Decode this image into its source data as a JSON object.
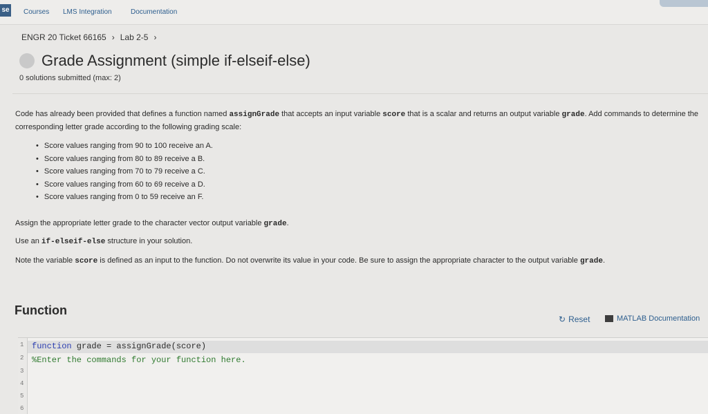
{
  "topbar": {
    "logo_text": "se",
    "nav": [
      "Courses",
      "LMS Integration",
      "Documentation"
    ]
  },
  "breadcrumb": {
    "items": [
      "ENGR 20 Ticket 66165",
      "Lab 2-5"
    ]
  },
  "assignment": {
    "title": "Grade Assignment (simple if-elseif-else)",
    "submitted": "0 solutions submitted (max: 2)"
  },
  "description": {
    "intro_1": "Code has already been provided that defines a function named ",
    "intro_code_1": "assignGrade",
    "intro_2": " that accepts an input variable ",
    "intro_code_2": "score",
    "intro_3": " that is a scalar and returns an output variable ",
    "intro_code_3": "grade",
    "intro_4": ". Add commands to determine the corresponding letter grade according to the following grading scale:",
    "bullets": [
      "Score values ranging from 90 to 100 receive an A.",
      "Score values ranging from 80 to 89 receive a B.",
      "Score values ranging from 70 to 79 receive a C.",
      "Score values ranging from 60 to 69 receive a D.",
      "Score values ranging from 0 to 59 receive an F."
    ],
    "assign_1": "Assign the appropriate letter grade to the character vector output variable ",
    "assign_code": "grade",
    "assign_2": ".",
    "use_1": "Use an ",
    "use_code": "if-elseif-else",
    "use_2": " structure in your solution.",
    "note_1": "Note the variable ",
    "note_code_1": "score",
    "note_2": " is defined as an input to the function.  Do not overwrite its value in your code.  Be sure to assign the appropriate character to the output variable ",
    "note_code_2": "grade",
    "note_3": "."
  },
  "function_section": {
    "title": "Function",
    "reset_label": "Reset",
    "doc_label": "MATLAB Documentation"
  },
  "editor": {
    "line_numbers": [
      "1",
      "2",
      "3",
      "4",
      "5",
      "6"
    ],
    "line1_keyword": "function",
    "line1_rest": " grade = assignGrade(score)",
    "line2_comment": "%Enter the commands for your function here."
  }
}
